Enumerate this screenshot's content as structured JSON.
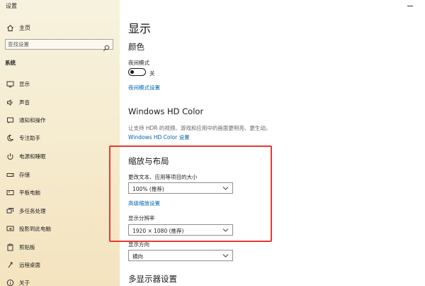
{
  "window": {
    "title": "设置"
  },
  "sidebar": {
    "home_label": "主页",
    "search_placeholder": "查找设置",
    "section_title": "系统",
    "items": [
      {
        "label": "显示",
        "icon": "monitor-icon"
      },
      {
        "label": "声音",
        "icon": "speaker-icon"
      },
      {
        "label": "通知和操作",
        "icon": "notification-icon"
      },
      {
        "label": "专注助手",
        "icon": "moon-icon"
      },
      {
        "label": "电源和睡眠",
        "icon": "power-icon"
      },
      {
        "label": "存储",
        "icon": "storage-icon"
      },
      {
        "label": "平板电脑",
        "icon": "tablet-icon"
      },
      {
        "label": "多任务处理",
        "icon": "multitask-icon"
      },
      {
        "label": "投影到此电脑",
        "icon": "project-icon"
      },
      {
        "label": "剪贴板",
        "icon": "clipboard-icon"
      },
      {
        "label": "远程桌面",
        "icon": "remote-desktop-icon"
      },
      {
        "label": "关于",
        "icon": "info-icon"
      }
    ]
  },
  "main": {
    "title": "显示",
    "color": {
      "heading": "颜色",
      "night_mode_label": "夜间模式",
      "toggle_state": "关",
      "night_settings_link": "夜间模式设置"
    },
    "hd_color": {
      "heading": "Windows HD Color",
      "description": "让支持 HDR 的视频、游戏和应用中的画面更明亮、更生动。",
      "settings_link": "Windows HD Color 设置"
    },
    "scale_layout": {
      "heading": "缩放与布局",
      "scale_label": "更改文本、应用等项目的大小",
      "scale_value": "100% (推荐)",
      "advanced_link": "高级缩放设置",
      "resolution_label": "显示分辨率",
      "resolution_value": "1920 × 1080 (推荐)",
      "orientation_label": "显示方向",
      "orientation_value": "横向"
    },
    "multi_display": {
      "heading": "多显示器设置"
    }
  },
  "colors": {
    "link": "#0063b1",
    "highlight_border": "#e53a35",
    "sidebar_bg": "#f6ecd0"
  }
}
